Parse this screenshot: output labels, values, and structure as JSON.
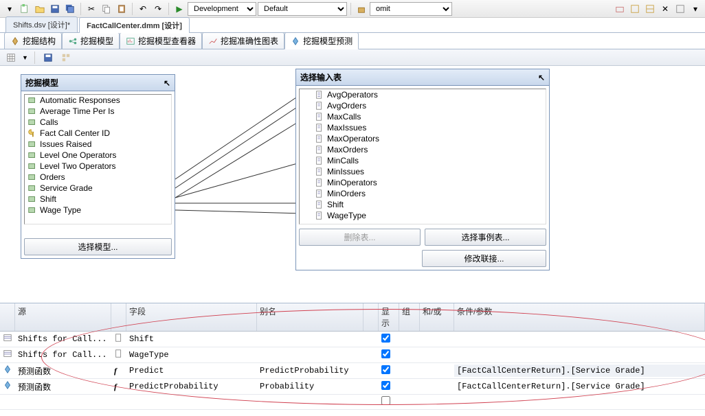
{
  "top_toolbar": {
    "combo1": "Development",
    "combo2": "Default",
    "combo3": "omit"
  },
  "doc_tabs": [
    {
      "label": "Shifts.dsv [设计]*",
      "active": false
    },
    {
      "label": "FactCallCenter.dmm [设计]",
      "active": true
    }
  ],
  "inner_tabs": [
    {
      "label": "挖掘结构",
      "active": false
    },
    {
      "label": "挖掘模型",
      "active": false
    },
    {
      "label": "挖掘模型查看器",
      "active": false
    },
    {
      "label": "挖掘准确性图表",
      "active": false
    },
    {
      "label": "挖掘模型预测",
      "active": true
    }
  ],
  "left_panel": {
    "title": "挖掘模型",
    "items": [
      "Automatic Responses",
      "Average Time Per Is",
      "Calls",
      "Fact Call Center ID",
      "Issues Raised",
      "Level One Operators",
      "Level Two Operators",
      "Orders",
      "Service Grade",
      "Shift",
      "Wage Type"
    ],
    "button": "选择模型..."
  },
  "right_panel": {
    "title": "选择输入表",
    "items": [
      "AvgOperators",
      "AvgOrders",
      "MaxCalls",
      "MaxIssues",
      "MaxOperators",
      "MaxOrders",
      "MinCalls",
      "MinIssues",
      "MinOperators",
      "MinOrders",
      "Shift",
      "WageType"
    ],
    "btn_delete": "删除表...",
    "btn_select_case": "选择事例表...",
    "btn_modify_join": "修改联接..."
  },
  "grid": {
    "headers": {
      "source": "源",
      "field": "字段",
      "alias": "别名",
      "show": "显示",
      "group": "组",
      "andor": "和/或",
      "criteria": "条件/参数"
    },
    "rows": [
      {
        "icon": "table",
        "source": "Shifts for Call...",
        "ficon": "col",
        "field": "Shift",
        "alias": "",
        "show": true,
        "criteria": ""
      },
      {
        "icon": "table",
        "source": "Shifts for Call...",
        "ficon": "col",
        "field": "WageType",
        "alias": "",
        "show": true,
        "criteria": ""
      },
      {
        "icon": "fx",
        "source": "预测函数",
        "ficon": "fn",
        "field": "Predict",
        "alias": "PredictProbability",
        "show": true,
        "criteria": "[FactCallCenterReturn].[Service Grade]"
      },
      {
        "icon": "fx",
        "source": "预测函数",
        "ficon": "fn",
        "field": "PredictProbability",
        "alias": "Probability",
        "show": true,
        "criteria": "[FactCallCenterReturn].[Service Grade]"
      }
    ]
  }
}
